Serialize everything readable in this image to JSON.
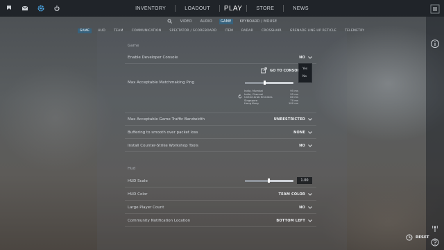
{
  "main_nav": [
    "INVENTORY",
    "LOADOUT",
    "PLAY",
    "STORE",
    "NEWS"
  ],
  "settings_tabs": [
    "VIDEO",
    "AUDIO",
    "GAME",
    "KEYBOARD / MOUSE"
  ],
  "game_tabs": [
    "GAME",
    "HUD",
    "TEAM",
    "COMMUNICATION",
    "SPECTATOR / SCOREBOARD",
    "ITEM",
    "RADAR",
    "CROSSHAIR",
    "GRENADE LINE-UP RETICLE",
    "TELEMETRY"
  ],
  "sections": {
    "game_title": "Game",
    "hud_title": "Hud"
  },
  "rows": {
    "developer_console": {
      "label": "Enable Developer Console",
      "value": "NO"
    },
    "console_link": "GO TO CONSOLE KE",
    "matchmaking_ping": {
      "label": "Max Acceptable Matchmaking Ping",
      "value": "150"
    },
    "traffic_bandwidth": {
      "label": "Max Acceptable Game Traffic Bandwidth",
      "value": "UNRESTRICTED"
    },
    "buffering": {
      "label": "Buffering to smooth over packet loss",
      "value": "NONE"
    },
    "workshop_tools": {
      "label": "Install Counter-Strike Workshop Tools",
      "value": "NO"
    },
    "hud_scale": {
      "label": "HUD Scale",
      "value": "1.00"
    },
    "hud_color": {
      "label": "HUD Color",
      "value": "TEAM COLOR"
    },
    "large_player_count": {
      "label": "Large Player Count",
      "value": "NO"
    },
    "community_notification": {
      "label": "Community Notification Location",
      "value": "BOTTOM LEFT"
    }
  },
  "dropdown_options": [
    "Yes",
    "No"
  ],
  "ping_list": [
    {
      "name": "India, Mumbai",
      "ms": "95 ms"
    },
    {
      "name": "India, Chennai",
      "ms": "95 ms"
    },
    {
      "name": "United Arab Emirates",
      "ms": "80 ms"
    },
    {
      "name": "Singapore",
      "ms": "70 ms"
    },
    {
      "name": "Hong Kong",
      "ms": "100 ms"
    }
  ],
  "reset_label": "RESET",
  "colors": {
    "accent_tab": "#37627d",
    "dropdown_bg": "#1b1f24"
  }
}
